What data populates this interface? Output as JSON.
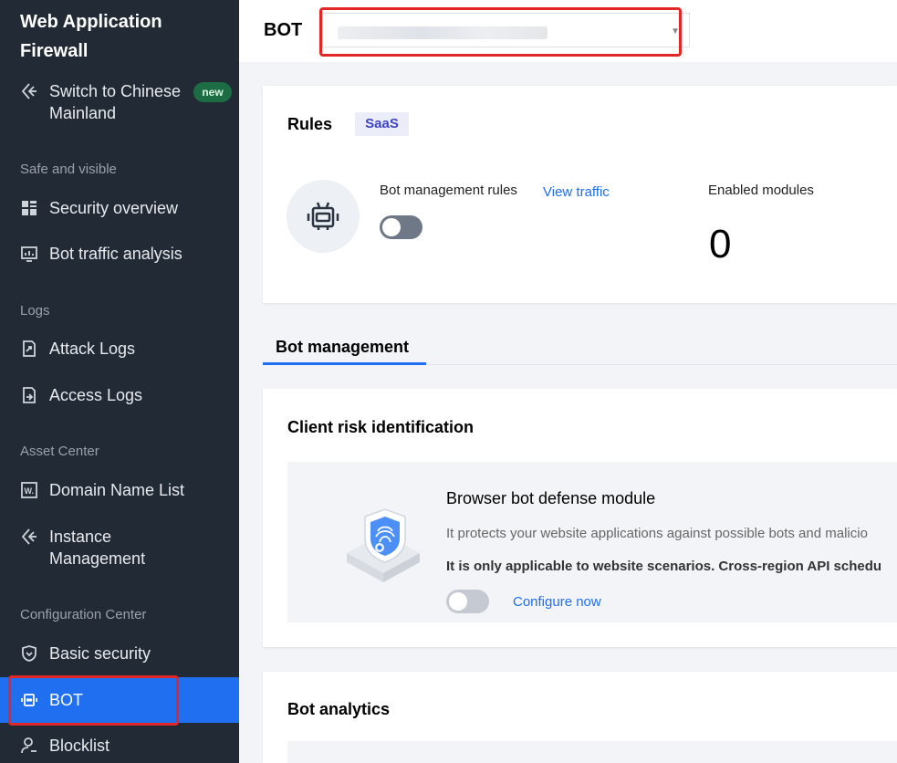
{
  "sidebar": {
    "app_title": "Web Application Firewall",
    "switch_label": "Switch to Chinese Mainland",
    "new_badge": "new",
    "groups": {
      "safe": "Safe and visible",
      "logs": "Logs",
      "asset": "Asset Center",
      "config": "Configuration Center"
    },
    "items": {
      "security_overview": "Security overview",
      "bot_traffic": "Bot traffic analysis",
      "attack_logs": "Attack Logs",
      "access_logs": "Access Logs",
      "domain_list": "Domain Name List",
      "instance_mgmt": "Instance Management",
      "basic_security": "Basic security",
      "bot": "BOT",
      "blocklist": "Blocklist"
    }
  },
  "header": {
    "title": "BOT",
    "instance_select_value": ""
  },
  "rules_card": {
    "title": "Rules",
    "badge": "SaaS",
    "bot_rules_label": "Bot management rules",
    "view_traffic": "View traffic",
    "enabled_modules_label": "Enabled modules",
    "enabled_modules_value": "0",
    "bot_rules_enabled": false
  },
  "tabs": {
    "active": "Bot management"
  },
  "client_risk": {
    "title": "Client risk identification",
    "module_title": "Browser bot defense module",
    "module_desc": "It protects your website applications against possible bots and malicio",
    "module_note": "It is only applicable to website scenarios. Cross-region API schedu",
    "configure_link": "Configure now",
    "module_enabled": false
  },
  "bot_analytics": {
    "title": "Bot analytics"
  },
  "colors": {
    "sidebar_bg": "#222a35",
    "accent": "#1f6ff0",
    "highlight_red": "#e32626"
  }
}
